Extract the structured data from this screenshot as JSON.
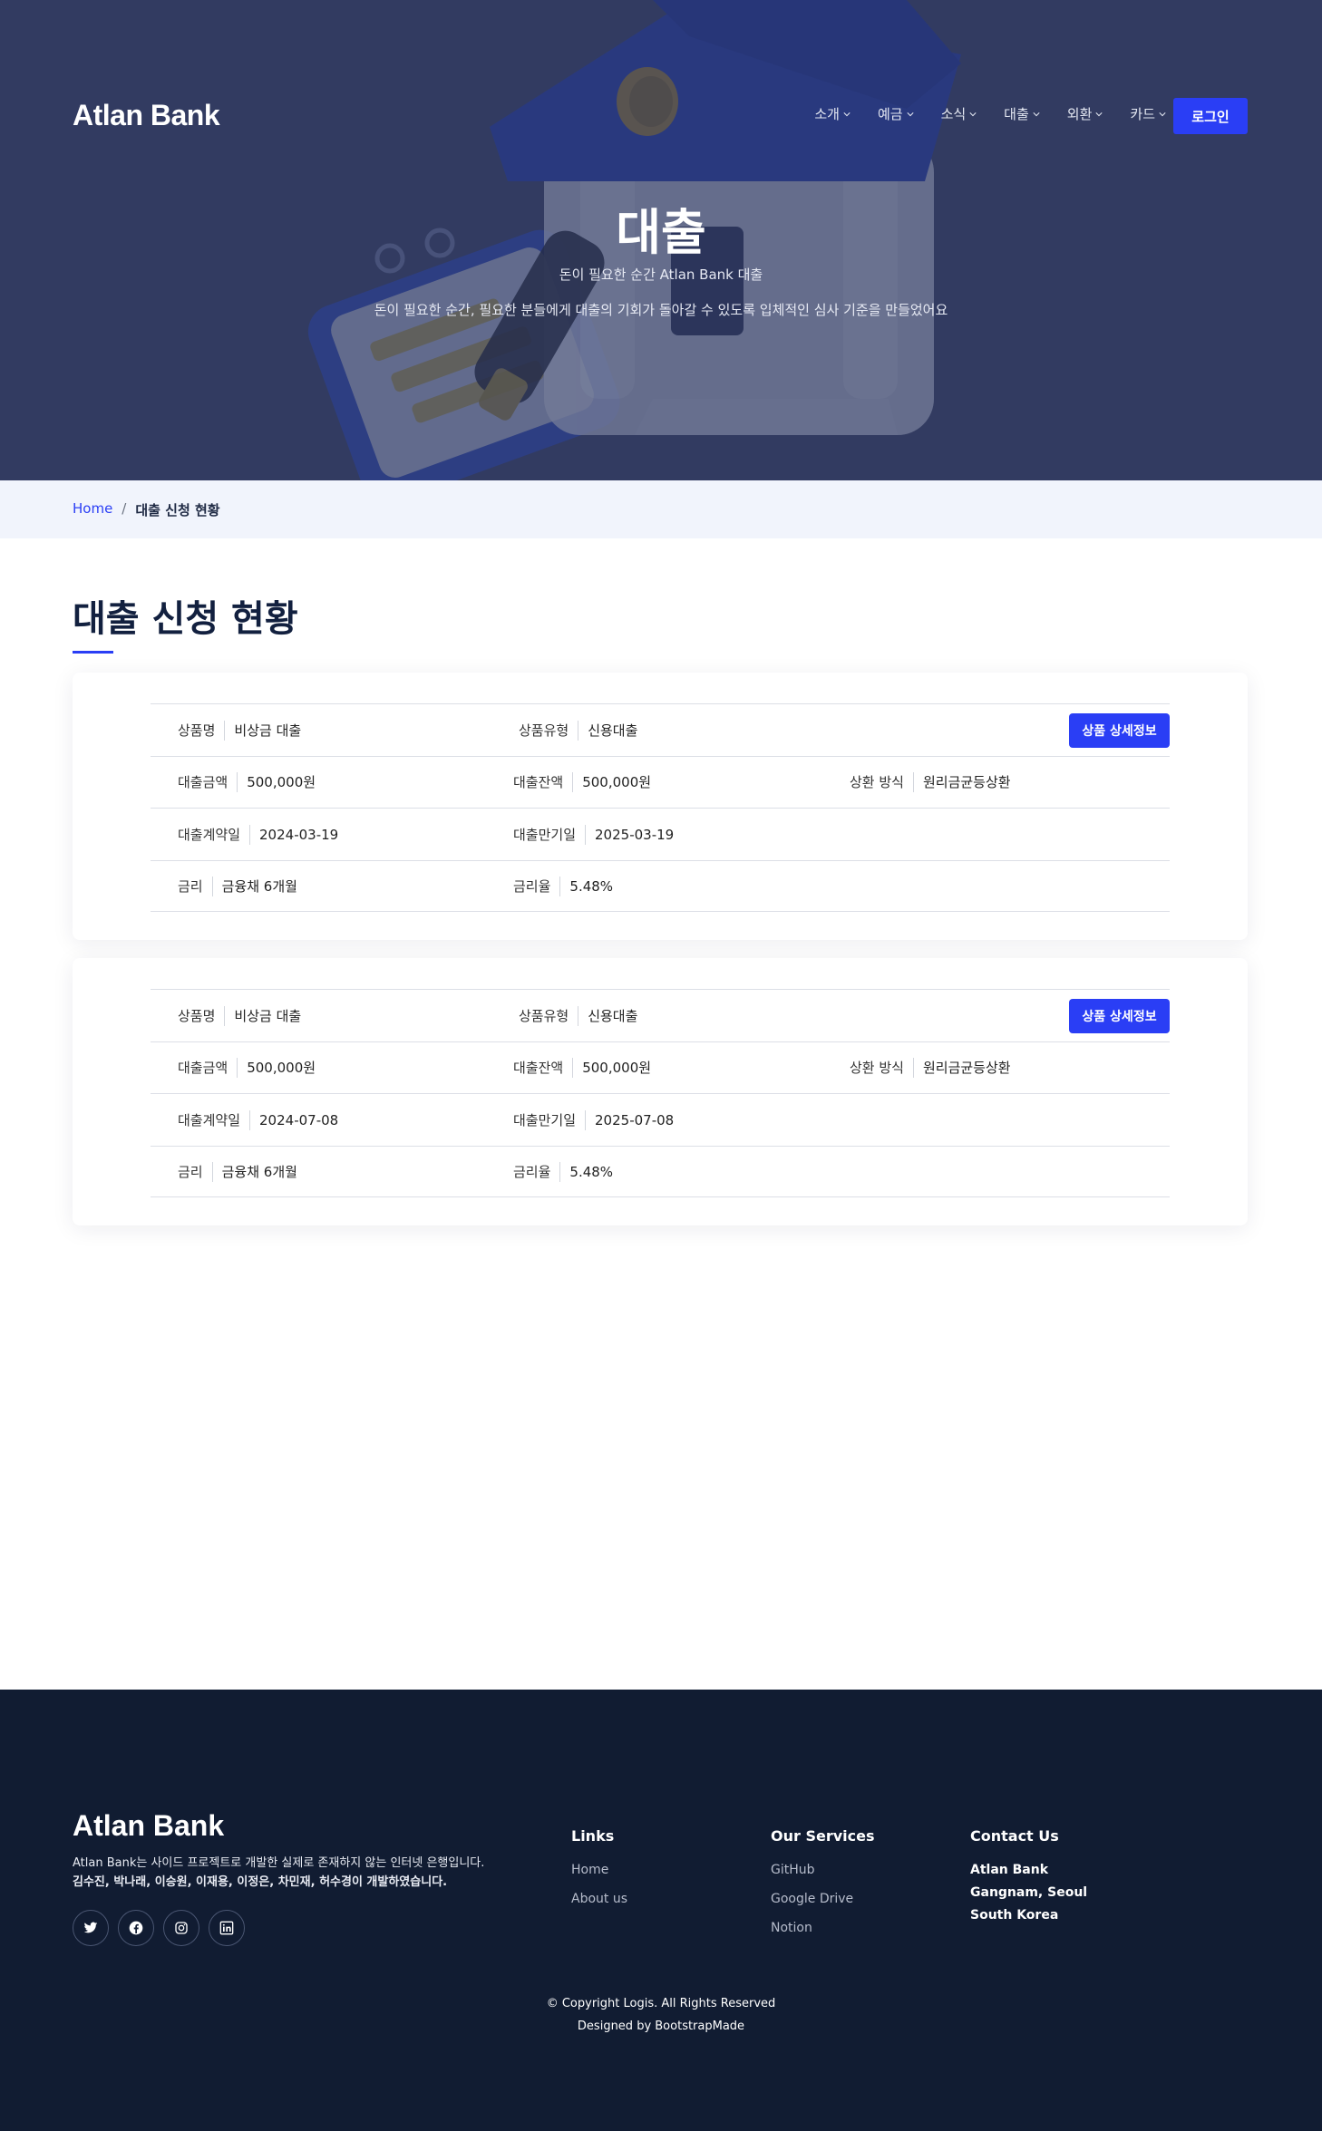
{
  "brand": {
    "accent": "#2a3ef5",
    "footer_bg": "#111c32"
  },
  "header": {
    "logo": "Atlan Bank",
    "nav": [
      {
        "label": "소개"
      },
      {
        "label": "예금"
      },
      {
        "label": "소식"
      },
      {
        "label": "대출"
      },
      {
        "label": "외환"
      },
      {
        "label": "카드"
      }
    ],
    "login_label": "로그인"
  },
  "hero": {
    "title": "대출",
    "subtitle": "돈이 필요한 순간 Atlan Bank 대출",
    "description": "돈이 필요한 순간, 필요한 분들에게 대출의 기회가 돌아갈 수 있도록 입체적인 심사 기준을 만들었어요"
  },
  "breadcrumb": {
    "home": "Home",
    "separator": "/",
    "current": "대출 신청 현황"
  },
  "section": {
    "title": "대출 신청 현황"
  },
  "loans": [
    {
      "product_name_label": "상품명",
      "product_name": "비상금 대출",
      "product_type_label": "상품유형",
      "product_type": "신용대출",
      "detail_button": "상품 상세정보",
      "amount_label": "대출금액",
      "amount": "500,000원",
      "balance_label": "대출잔액",
      "balance": "500,000원",
      "repay_label": "상환 방식",
      "repay": "원리금균등상환",
      "contract_label": "대출계약일",
      "contract": "2024-03-19",
      "maturity_label": "대출만기일",
      "maturity": "2025-03-19",
      "rate_base_label": "금리",
      "rate_base": "금융채 6개월",
      "rate_label": "금리율",
      "rate": "5.48%"
    },
    {
      "product_name_label": "상품명",
      "product_name": "비상금 대출",
      "product_type_label": "상품유형",
      "product_type": "신용대출",
      "detail_button": "상품 상세정보",
      "amount_label": "대출금액",
      "amount": "500,000원",
      "balance_label": "대출잔액",
      "balance": "500,000원",
      "repay_label": "상환 방식",
      "repay": "원리금균등상환",
      "contract_label": "대출계약일",
      "contract": "2024-07-08",
      "maturity_label": "대출만기일",
      "maturity": "2025-07-08",
      "rate_base_label": "금리",
      "rate_base": "금융채 6개월",
      "rate_label": "금리율",
      "rate": "5.48%"
    }
  ],
  "footer": {
    "logo": "Atlan Bank",
    "desc1": "Atlan Bank는 사이드 프로젝트로 개발한 실제로 존재하지 않는 인터넷 은행입니다.",
    "desc2": "김수진, 박나래, 이승원, 이재용, 이정은, 차민재, 허수경이 개발하였습니다.",
    "socials": [
      "twitter-icon",
      "facebook-icon",
      "instagram-icon",
      "linkedin-icon"
    ],
    "links": {
      "title": "Links",
      "items": [
        "Home",
        "About us"
      ]
    },
    "services": {
      "title": "Our Services",
      "items": [
        "GitHub",
        "Google Drive",
        "Notion"
      ]
    },
    "contact": {
      "title": "Contact Us",
      "lines": [
        "Atlan Bank",
        "Gangnam, Seoul",
        "South Korea"
      ]
    },
    "copyright": "© Copyright Logis. All Rights Reserved",
    "designed": "Designed by BootstrapMade"
  }
}
